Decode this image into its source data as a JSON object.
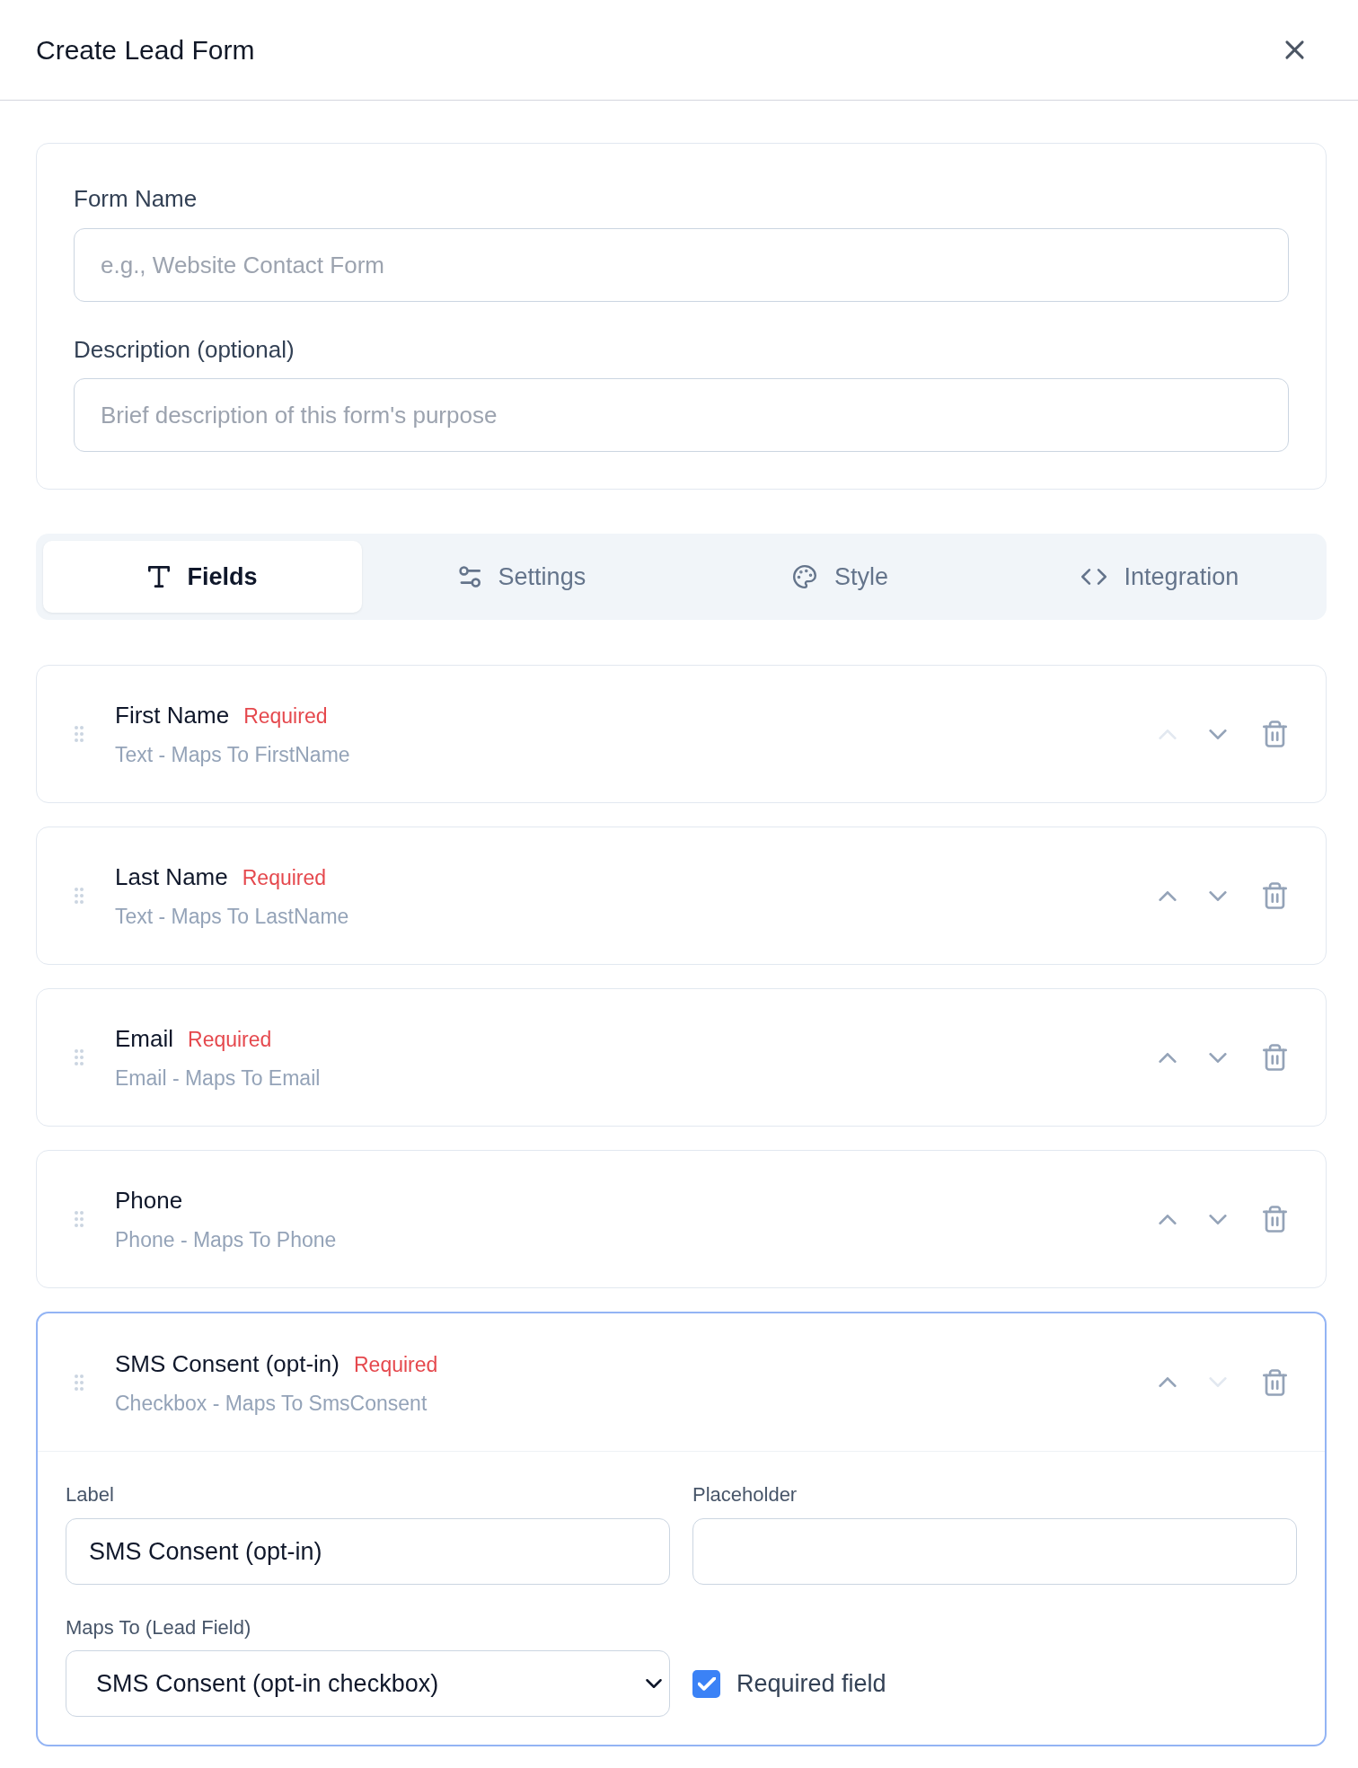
{
  "window": {
    "title": "Create Lead Form"
  },
  "form": {
    "name_field": {
      "label": "Form Name",
      "placeholder": "e.g., Website Contact Form"
    },
    "description_field": {
      "label": "Description (optional)",
      "placeholder": "Brief description of this form's purpose"
    }
  },
  "tabs": [
    {
      "label": "Fields",
      "selected": true
    },
    {
      "label": "Settings",
      "selected": false
    },
    {
      "label": "Style",
      "selected": false
    },
    {
      "label": "Integration",
      "selected": false
    }
  ],
  "fields": [
    {
      "name": "First Name",
      "tag": "Required",
      "summary": "Text - Maps To FirstName",
      "up_disabled": true,
      "down_disabled": false,
      "expanded": false
    },
    {
      "name": "Last Name",
      "tag": "Required",
      "summary": "Text - Maps To LastName",
      "up_disabled": false,
      "down_disabled": false,
      "expanded": false
    },
    {
      "name": "Email",
      "tag": "Required",
      "summary": "Email - Maps To Email",
      "up_disabled": false,
      "down_disabled": false,
      "expanded": false
    },
    {
      "name": "Phone",
      "summary": "Phone - Maps To Phone",
      "up_disabled": false,
      "down_disabled": false,
      "expanded": false
    },
    {
      "name": "SMS Consent (opt-in)",
      "tag": "Required",
      "summary": "Checkbox - Maps To SmsConsent",
      "up_disabled": false,
      "down_disabled": true,
      "expanded": true,
      "editor": {
        "label_field": {
          "label": "Label",
          "value": "SMS Consent (opt-in)"
        },
        "placeholder_field": {
          "label": "Placeholder"
        },
        "maps_to": {
          "label": "Maps To (Lead Field)",
          "value": "SMS Consent (opt-in checkbox)"
        },
        "required_checkbox": {
          "label": "Required field",
          "checked": true
        }
      }
    }
  ]
}
